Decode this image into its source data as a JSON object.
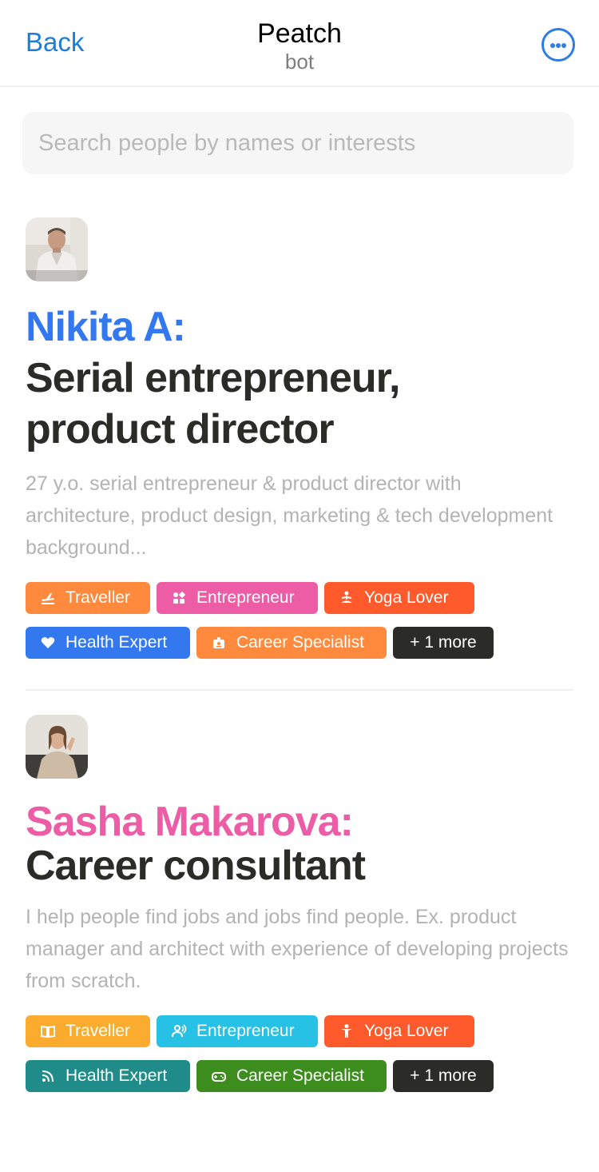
{
  "header": {
    "back_label": "Back",
    "title": "Peatch",
    "subtitle": "bot",
    "more_icon": "ellipsis-circle-icon"
  },
  "search": {
    "placeholder": "Search people by names or interests",
    "value": ""
  },
  "colors": {
    "link_blue": "#1e7ed6",
    "name_blue": "#3478f0",
    "name_pink": "#ec5da6",
    "heading_dark": "#2b2b28",
    "bio_gray": "#b3b3b3"
  },
  "profiles": [
    {
      "name": "Nikita A:",
      "name_color": "#3478f0",
      "role_lines": [
        "Serial entrepreneur,",
        "product director"
      ],
      "bio": "27 y.o. serial entrepreneur & product director with architecture, product design, marketing & tech development background...",
      "tags": [
        {
          "label": "Traveller",
          "icon": "plane-icon",
          "color": "#ff8a3d"
        },
        {
          "label": "Entrepreneur",
          "icon": "grid-icon",
          "color": "#ec5da6"
        },
        {
          "label": "Yoga Lover",
          "icon": "meditation-icon",
          "color": "#ff5a2c"
        },
        {
          "label": "Health Expert",
          "icon": "heart-icon",
          "color": "#3478f0"
        },
        {
          "label": "Career Specialist",
          "icon": "badge-icon",
          "color": "#ff8a3d"
        }
      ],
      "more_label": "+ 1 more"
    },
    {
      "name": "Sasha Makarova:",
      "name_color": "#ec5da6",
      "role_lines": [
        "Career consultant"
      ],
      "bio": "I help people find jobs and jobs find people. Ex. product manager and architect with experience of developing projects from scratch.",
      "tags": [
        {
          "label": "Traveller",
          "icon": "book-icon",
          "color": "#fbab2e"
        },
        {
          "label": "Entrepreneur",
          "icon": "people-icon",
          "color": "#27c1e6"
        },
        {
          "label": "Yoga Lover",
          "icon": "person-icon",
          "color": "#ff5a2c"
        },
        {
          "label": "Health Expert",
          "icon": "rss-icon",
          "color": "#1f8c89"
        },
        {
          "label": "Career Specialist",
          "icon": "gamepad-icon",
          "color": "#3d8d1e"
        }
      ],
      "more_label": "+ 1 more"
    }
  ]
}
